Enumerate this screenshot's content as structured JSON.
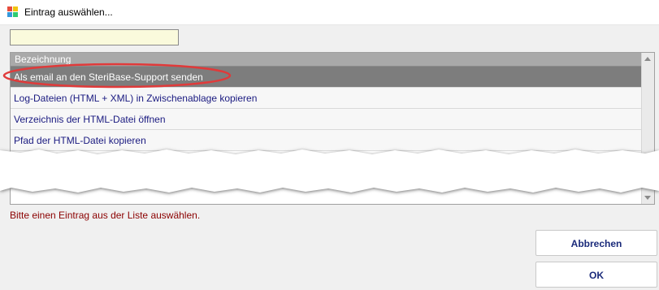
{
  "window": {
    "title": "Eintrag auswählen..."
  },
  "search": {
    "value": ""
  },
  "grid": {
    "column_header": "Bezeichnung",
    "rows": [
      {
        "label": "Als email an den SteriBase-Support senden",
        "selected": true
      },
      {
        "label": "Log-Dateien (HTML + XML) in Zwischenablage kopieren",
        "selected": false
      },
      {
        "label": "Verzeichnis der HTML-Datei öffnen",
        "selected": false
      },
      {
        "label": "Pfad der HTML-Datei kopieren",
        "selected": false
      }
    ]
  },
  "status": {
    "message": "Bitte einen Eintrag aus der Liste auswählen."
  },
  "buttons": {
    "cancel_label": "Abbrechen",
    "ok_label": "OK"
  },
  "colors": {
    "selection_background": "#7d7d7d",
    "row_text": "#1a1a80",
    "status_text": "#8b0000",
    "highlight_ellipse": "#e03a3a",
    "search_background": "#fafadc"
  }
}
